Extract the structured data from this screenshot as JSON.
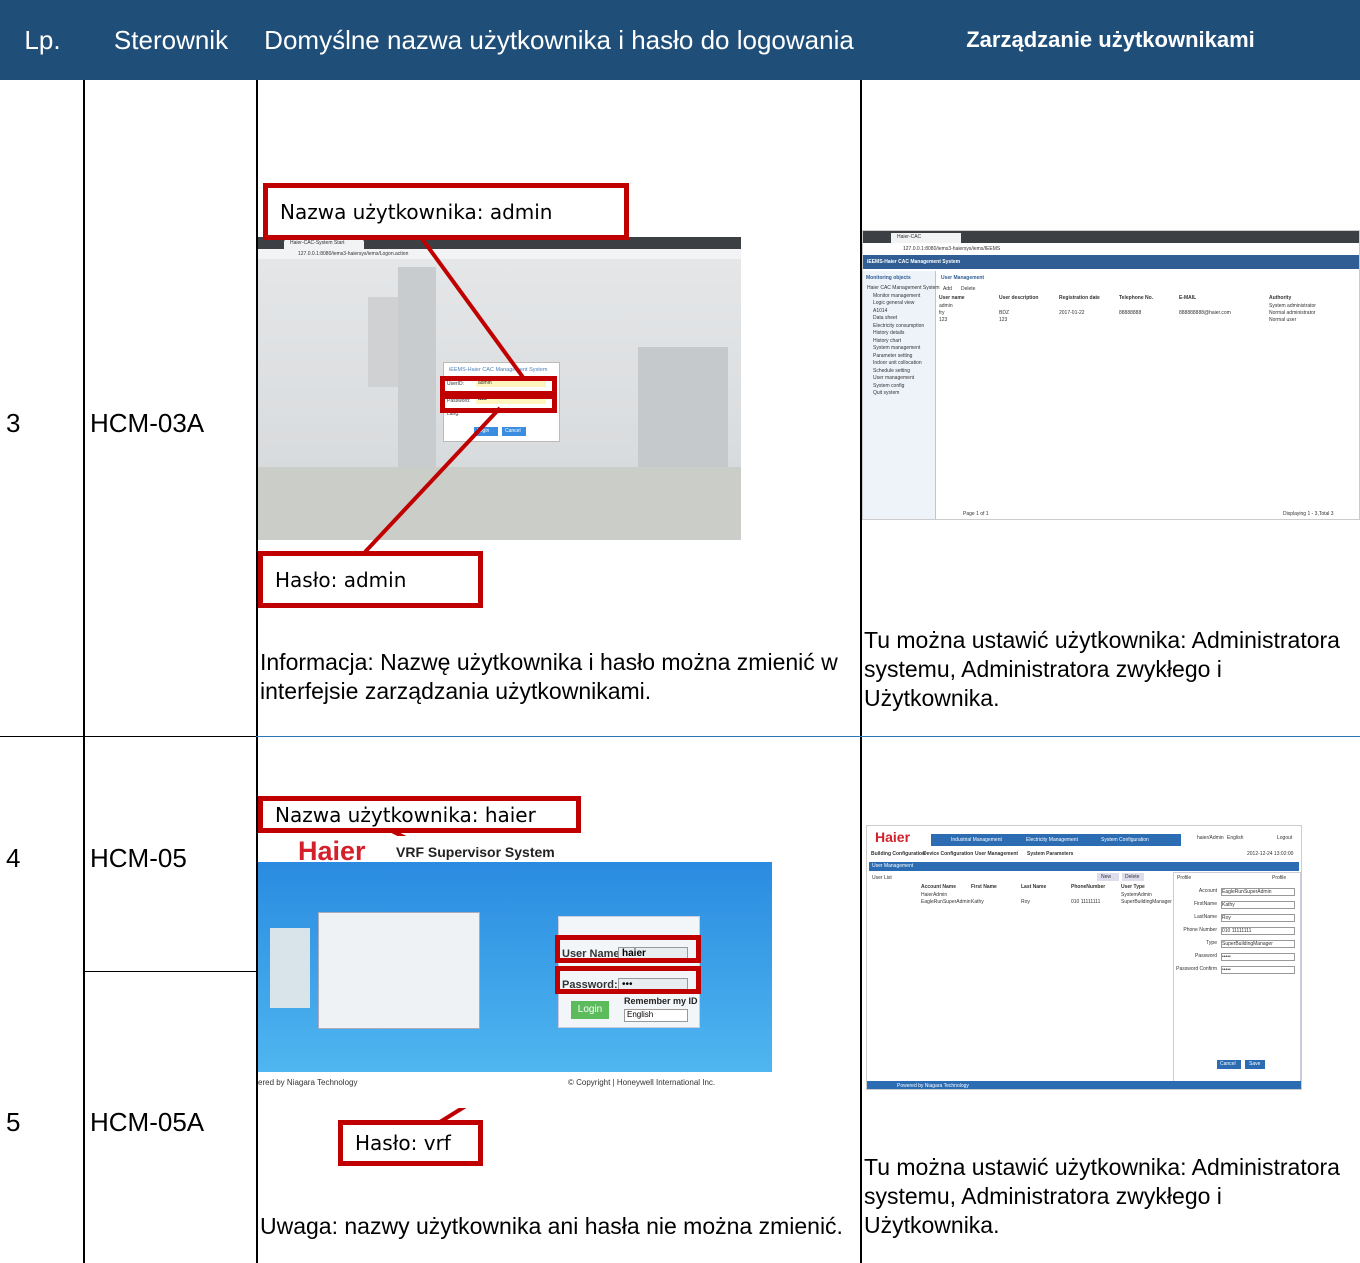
{
  "colors": {
    "header_bg": "#1F4E79",
    "annotation_red": "#C00000"
  },
  "header": {
    "col_lp": "Lp.",
    "col_controller": "Sterownik",
    "col_credentials": "Domyślne nazwa użytkownika i hasło do logowania",
    "col_user_mgmt": "Zarządzanie użytkownikami"
  },
  "rows": [
    {
      "lp": "3",
      "controller": "HCM-03A",
      "username_label": "Nazwa użytkownika: admin",
      "password_label": "Hasło: admin",
      "info": "Informacja: Nazwę użytkownika i hasło można zmienić w interfejsie zarządzania użytkownikami.",
      "mgmt_note": "Tu można ustawić użytkownika: Administratora systemu, Administratora zwykłego i Użytkownika.",
      "login_shot": {
        "tab": "Haier-CAC-System Start",
        "url": "127.0.0.1:8080/iems3-haiersys/iems/Logon.action",
        "dialog_title": "iEEMS-Haier CAC Management System",
        "user_label": "UserID:",
        "user_value": "admin",
        "pass_label": "Password:",
        "pass_value": "•••••",
        "lang_label": "Lang:",
        "login_btn": "Login",
        "cancel_btn": "Cancel"
      },
      "mgmt_shot": {
        "tab": "Haier-CAC",
        "url": "127.0.0.1:8080/iems3-haiersys/iems/IEEMS",
        "app_title": "iEEMS-Haier CAC Management System",
        "tree_title": "Monitoring objects",
        "tree": [
          "Haier CAC Management System",
          "Monitor management",
          "Logic general view",
          "A1014",
          "Data sheet",
          "Electricity consumption",
          "History details",
          "History chart",
          "System management",
          "Parameter setting",
          "Indoor unit collocation",
          "Schedule setting",
          "User management",
          "System config",
          "Quit system"
        ],
        "panel_title": "User Management",
        "add_btn": "Add",
        "delete_btn": "Delete",
        "columns": [
          "User name",
          "User description",
          "Registration date",
          "Telephone No.",
          "E-MAIL",
          "Authority"
        ],
        "rows": [
          [
            "admin",
            "",
            "",
            "",
            "",
            "System administrator"
          ],
          [
            "fry",
            "BDZ",
            "2017-01-22",
            "88888888",
            "888888888@haier.com",
            "Normal administrator"
          ],
          [
            "123",
            "123",
            "",
            "",
            "",
            "Normal user"
          ]
        ],
        "pager": "Page 1 of 1",
        "displaying": "Displaying 1 - 3,Total 3"
      }
    },
    {
      "lp": "4",
      "controller": "HCM-05",
      "username_label": "Nazwa użytkownika: haier",
      "password_label": "Hasło: vrf",
      "info": "Uwaga: nazwy użytkownika ani hasła nie można zmienić.",
      "mgmt_note": "Tu można ustawić użytkownika: Administratora systemu, Administratora zwykłego i Użytkownika.",
      "login_shot": {
        "brand": "Haier",
        "product": "VRF Supervisor System",
        "user_label": "User Name:",
        "user_value": "haier",
        "pass_label": "Password:",
        "pass_value": "•••",
        "login_btn": "Login",
        "remember": "Remember my ID",
        "language": "English",
        "footer_left": "ered by Niagara Technology",
        "footer_right": "© Copyright | Honeywell International Inc."
      },
      "mgmt_shot": {
        "brand": "Haier",
        "tabs": [
          "Industrial Management",
          "Electricity Management",
          "System Configuration"
        ],
        "top_right": "haier/Admin",
        "lang": "English",
        "logout": "Logout",
        "subnav": [
          "Building Configuration",
          "Device Configuration",
          "User Management",
          "System Parameters"
        ],
        "datetime": "2012-12-24 13:02:00",
        "section": "User Management",
        "list_title": "User List",
        "new_btn": "New",
        "delete_btn": "Delete",
        "columns": [
          "Account Name",
          "First Name",
          "Last Name",
          "PhoneNumber",
          "User Type"
        ],
        "rows": [
          [
            "HaierAdmin",
            "",
            "",
            "",
            "SystemAdmin"
          ],
          [
            "EagleRunSuperAdmin",
            "Kathy",
            "Roy",
            "010 11111111",
            "SuperBuildingManager"
          ]
        ],
        "profile_title": "Profile",
        "profile_tab": "Profile",
        "fields": [
          {
            "label": "Account",
            "value": "EagleRunSuperAdmin"
          },
          {
            "label": "FirstName",
            "value": "Kathy"
          },
          {
            "label": "LastName",
            "value": "Roy"
          },
          {
            "label": "Phone Number",
            "value": "010 11111111"
          },
          {
            "label": "Type",
            "value": "SuperBuildingManager"
          },
          {
            "label": "Password",
            "value": "•••••"
          },
          {
            "label": "Password Confirm",
            "value": "•••••"
          }
        ],
        "cancel_btn": "Cancel",
        "save_btn": "Save",
        "footer": "Powered by Niagara Technology"
      }
    },
    {
      "lp": "5",
      "controller": "HCM-05A"
    }
  ]
}
